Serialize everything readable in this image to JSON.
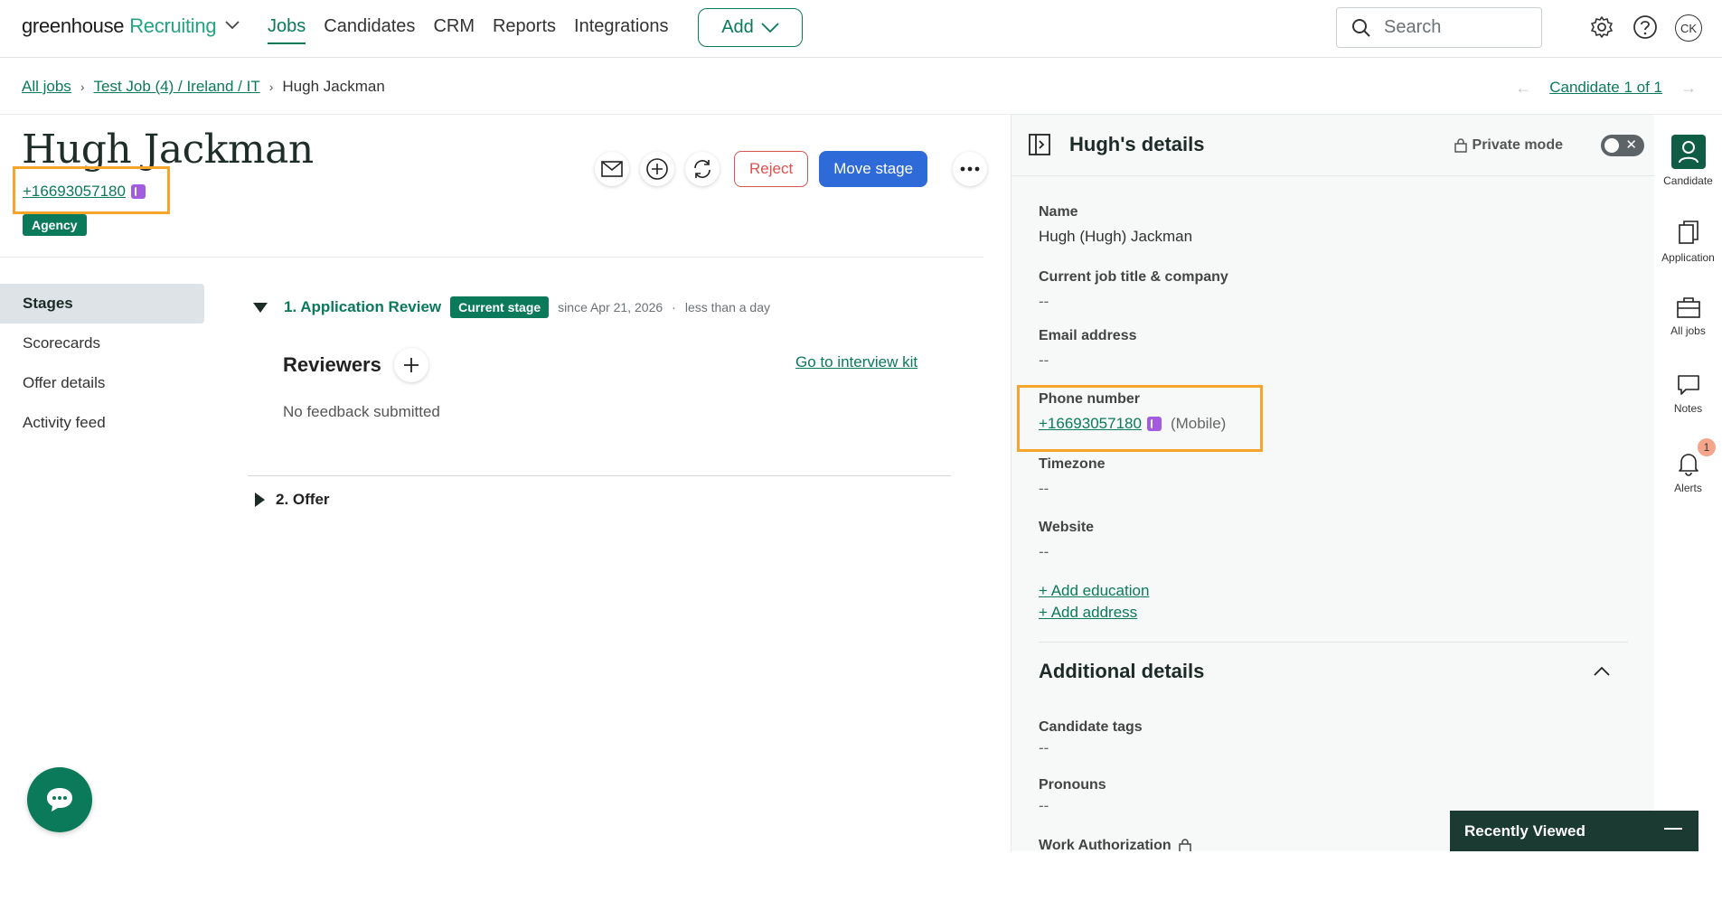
{
  "nav": {
    "brand": "greenhouse",
    "product": "Recruiting",
    "links": [
      "Jobs",
      "Candidates",
      "CRM",
      "Reports",
      "Integrations"
    ],
    "add_label": "Add",
    "search_placeholder": "Search",
    "avatar_initials": "CK"
  },
  "breadcrumb": {
    "all_jobs": "All jobs",
    "job": "Test Job (4) / Ireland / IT",
    "current": "Hugh Jackman",
    "candidate_pager": "Candidate 1 of 1"
  },
  "candidate": {
    "name": "Hugh Jackman",
    "phone": "+16693057180",
    "source_badge": "Agency"
  },
  "actions": {
    "reject_label": "Reject",
    "move_stage_label": "Move stage"
  },
  "sidenav": {
    "items": [
      "Stages",
      "Scorecards",
      "Offer details",
      "Activity feed"
    ]
  },
  "stages": {
    "stage1_title": "1. Application Review",
    "current_badge": "Current stage",
    "since": "since Apr 21, 2026",
    "dot": "·",
    "duration": "less than a day",
    "reviewers_label": "Reviewers",
    "interview_kit_link": "Go to interview kit",
    "no_feedback": "No feedback submitted",
    "stage2_title": "2. Offer"
  },
  "details": {
    "title": "Hugh's details",
    "private_mode": "Private mode",
    "name_label": "Name",
    "name_value": "Hugh (Hugh) Jackman",
    "job_label": "Current job title & company",
    "job_value": "--",
    "email_label": "Email address",
    "email_value": "--",
    "phone_label": "Phone number",
    "phone_value": "+16693057180",
    "phone_type": "(Mobile)",
    "timezone_label": "Timezone",
    "timezone_value": "--",
    "website_label": "Website",
    "website_value": "--",
    "add_education": "+ Add education",
    "add_address": "+ Add address",
    "additional_title": "Additional details",
    "tags_label": "Candidate tags",
    "tags_value": "--",
    "pronouns_label": "Pronouns",
    "pronouns_value": "--",
    "work_auth_label": "Work Authorization"
  },
  "rail": {
    "candidate": "Candidate",
    "application": "Application",
    "all_jobs": "All jobs",
    "notes": "Notes",
    "alerts": "Alerts",
    "alerts_count": "1"
  },
  "recently_viewed": "Recently Viewed",
  "colors": {
    "brand_green": "#0a7a5a",
    "highlight_orange": "#f7a42b",
    "primary_blue": "#2e6ad8",
    "reject_red": "#d9534f"
  }
}
